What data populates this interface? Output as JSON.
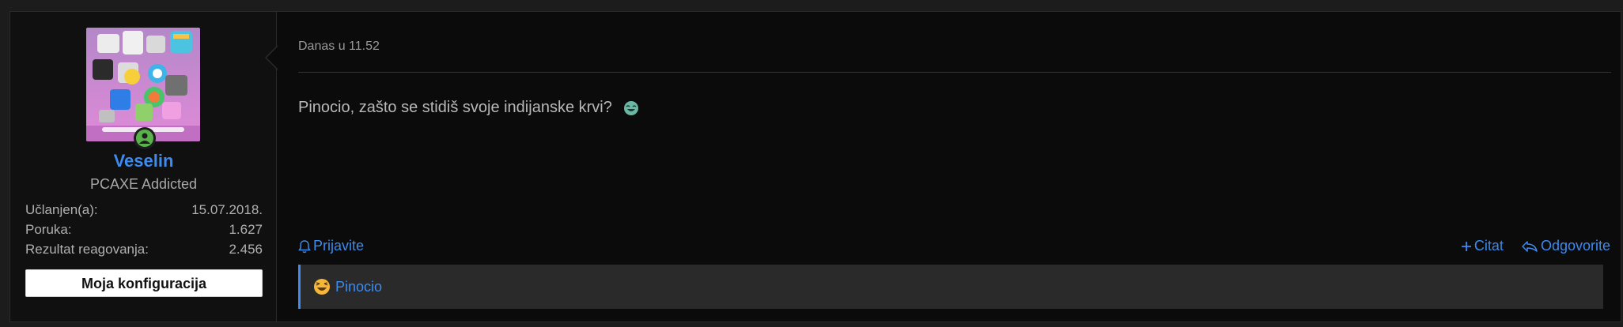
{
  "user": {
    "name": "Veselin",
    "title": "PCAXE Addicted",
    "stats": [
      {
        "label": "Učlanjen(a):",
        "value": "15.07.2018."
      },
      {
        "label": "Poruka:",
        "value": "1.627"
      },
      {
        "label": "Rezultat reagovanja:",
        "value": "2.456"
      }
    ],
    "config_button": "Moja konfiguracija",
    "status": "online"
  },
  "post": {
    "date": "Danas u 11.52",
    "message": "Pinocio, zašto se stidiš svoje indijanske krvi?",
    "smilie": "laughing-smilie"
  },
  "actions": {
    "report": "Prijavite",
    "quote": "Citat",
    "reply": "Odgovorite"
  },
  "reactions": {
    "names": "Pinocio",
    "icon": "haha-reaction-icon"
  },
  "colors": {
    "accent": "#3d8bf0",
    "online": "#5ab34a",
    "background": "#0b0b0b"
  }
}
